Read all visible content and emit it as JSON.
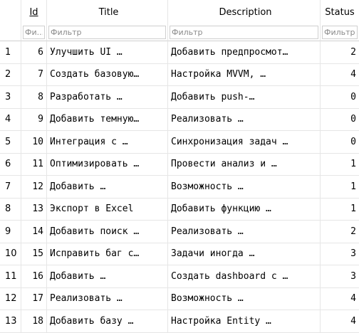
{
  "columns": {
    "id": "Id",
    "title": "Title",
    "description": "Description",
    "status": "Status"
  },
  "filters": {
    "id": "Фи...",
    "title": "Фильтр",
    "description": "Фильтр",
    "status": "Фильтр"
  },
  "rows": [
    {
      "rownum": "1",
      "id": "6",
      "title": "Улучшить UI …",
      "description": "Добавить предпросмот…",
      "status": "2"
    },
    {
      "rownum": "2",
      "id": "7",
      "title": "Создать базовую…",
      "description": "Настройка MVVM, …",
      "status": "4"
    },
    {
      "rownum": "3",
      "id": "8",
      "title": "Разработать …",
      "description": "Добавить push-…",
      "status": "0"
    },
    {
      "rownum": "4",
      "id": "9",
      "title": "Добавить темную…",
      "description": "Реализовать …",
      "status": "0"
    },
    {
      "rownum": "5",
      "id": "10",
      "title": "Интеграция с …",
      "description": "Синхронизация задач …",
      "status": "0"
    },
    {
      "rownum": "6",
      "id": "11",
      "title": "Оптимизировать …",
      "description": "Провести анализ и …",
      "status": "1"
    },
    {
      "rownum": "7",
      "id": "12",
      "title": "Добавить …",
      "description": "Возможность …",
      "status": "1"
    },
    {
      "rownum": "8",
      "id": "13",
      "title": "Экспорт в Excel",
      "description": "Добавить функцию …",
      "status": "1"
    },
    {
      "rownum": "9",
      "id": "14",
      "title": "Добавить поиск …",
      "description": "Реализовать …",
      "status": "2"
    },
    {
      "rownum": "10",
      "id": "15",
      "title": "Исправить баг с…",
      "description": "Задачи иногда …",
      "status": "3"
    },
    {
      "rownum": "11",
      "id": "16",
      "title": "Добавить …",
      "description": "Создать dashboard с …",
      "status": "3"
    },
    {
      "rownum": "12",
      "id": "17",
      "title": "Реализовать …",
      "description": "Возможность …",
      "status": "4"
    },
    {
      "rownum": "13",
      "id": "18",
      "title": "Добавить базу …",
      "description": "Настройка Entity …",
      "status": "4"
    }
  ]
}
